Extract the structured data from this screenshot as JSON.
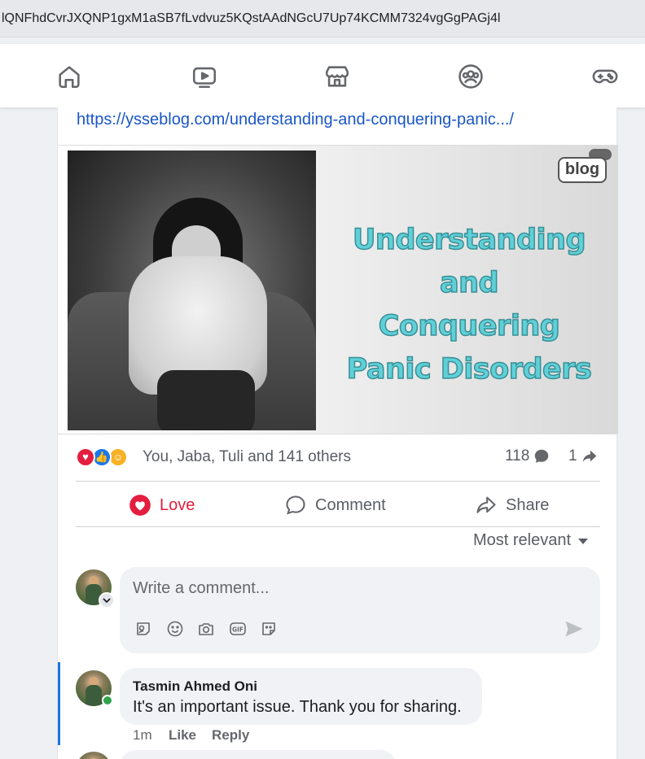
{
  "browser": {
    "url_fragment": "lQNFhdCvrJXQNP1gxM1aSB7fLvdvuz5KQstAAdNGcU7Up74KCMM7324vgGgPAGj4l"
  },
  "top_nav": {
    "icons": [
      "home-icon",
      "video-icon",
      "marketplace-icon",
      "groups-icon",
      "gaming-icon"
    ]
  },
  "post": {
    "link_text": "https://ysseblog.com/understanding-and-conquering-panic.../",
    "banner": {
      "logo_text": "blog",
      "headline_lines": [
        "Understanding",
        "and",
        "Conquering",
        "Panic Disorders"
      ]
    },
    "reactions": {
      "summary": "You, Jaba, Tuli and 141 others",
      "types": [
        "love",
        "like",
        "care"
      ],
      "comment_count": "118",
      "share_count": "1"
    },
    "actions": {
      "love_label": "Love",
      "comment_label": "Comment",
      "share_label": "Share"
    },
    "sort_label": "Most relevant",
    "composer": {
      "placeholder": "Write a comment...",
      "tools": [
        "avatar-sticker-icon",
        "emoji-icon",
        "camera-icon",
        "gif-icon",
        "sticker-icon"
      ]
    },
    "comments": [
      {
        "author": "Tasmin Ahmed Oni",
        "text": "It's an important issue. Thank you for sharing.",
        "time": "1m",
        "like_label": "Like",
        "reply_label": "Reply"
      }
    ]
  },
  "colors": {
    "link": "#1a56c8",
    "love": "#e41e3f",
    "like": "#1877f2",
    "care": "#f7b125",
    "headline_fill": "#5fd0d8",
    "accent_bar": "#1b74e4",
    "online": "#31a24c"
  }
}
